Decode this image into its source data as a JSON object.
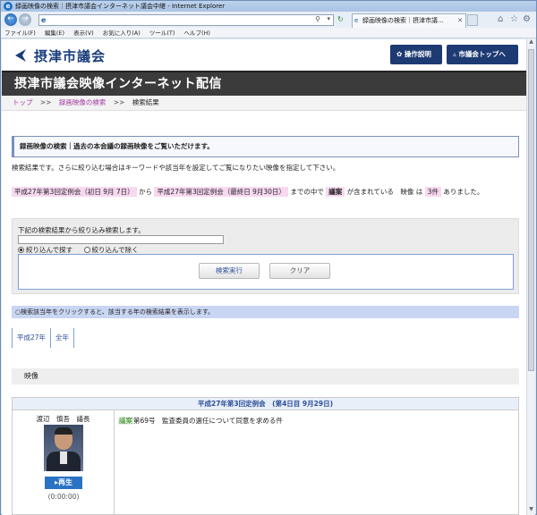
{
  "browser": {
    "title": "録画映像の検索｜摂津市議会インターネット議会中継 - Internet Explorer",
    "tab_label": "録画映像の検索｜摂津市議...",
    "menu": [
      "ファイル(F)",
      "編集(E)",
      "表示(V)",
      "お気に入り(A)",
      "ツール(T)",
      "ヘルプ(H)"
    ]
  },
  "header": {
    "logo": "摂津市議会",
    "help_button": "操作説明",
    "top_button": "市議会トップへ"
  },
  "banner": "摂津市議会映像インターネット配信",
  "breadcrumb": {
    "home": "トップ",
    "sep": ">>",
    "search": "録画映像の検索",
    "current": "検索結果"
  },
  "notice": "録画映像の検索｜過去の本会議の録画映像をご覧いただけます。",
  "description": "検索結果です。さらに絞り込む場合はキーワードや該当年を設定してご覧になりたい映像を指定して下さい。",
  "conditions": {
    "from": "平成27年第3回定例会（初日 9月 7日）",
    "from_suffix": "から",
    "to": "平成27年第3回定例会（最終日 9月30日）",
    "to_suffix": "までの中で",
    "keyword": "議案",
    "keyword_suffix": "が含まれている　映像 は",
    "count": "3件",
    "count_suffix": "ありました。"
  },
  "refine": {
    "label": "下記の検索結果から絞り込み検索します。",
    "input_value": "",
    "option_include": "絞り込んで探す",
    "option_exclude": "絞り込んで除く",
    "search_button": "検索実行",
    "clear_button": "クリア"
  },
  "years_note": "○検索該当年をクリックすると、該当する年の検索結果を表示します。",
  "year_tabs": [
    "平成27年",
    "全年"
  ],
  "video_heading": "映像",
  "session": {
    "title": "平成27年第3回定例会　(第4日目 9月29日)",
    "speaker": "渡辺　慎吾　議長",
    "play": "再生",
    "time": "(0:00:00)",
    "topic_tag": "議案",
    "topic_text": "第69号　監査委員の選任について同意を求める件"
  }
}
